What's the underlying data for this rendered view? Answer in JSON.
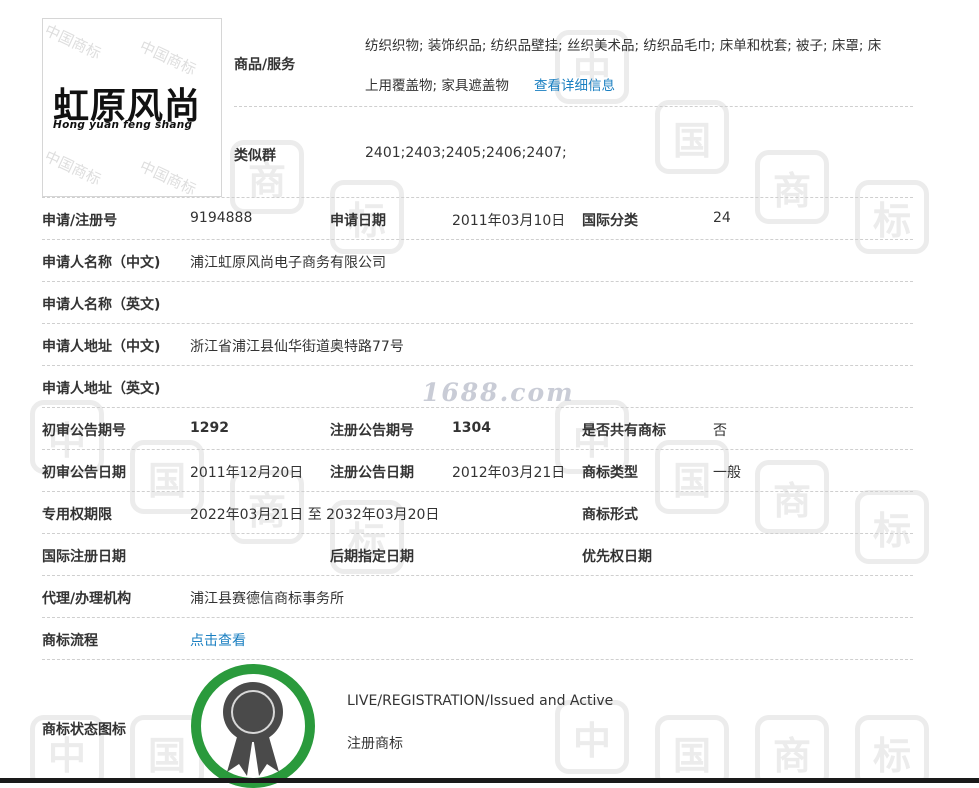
{
  "logo": {
    "main_text": "虹原风尚",
    "sub_text": "Hong yuan feng shang",
    "watermark": "中国商标"
  },
  "goods": {
    "label": "商品/服务",
    "text_line1": "纺织织物; 装饰织品; 纺织品壁挂; 丝织美术品; 纺织品毛巾; 床单和枕套; 被子; 床罩; 床",
    "text_line2": "上用覆盖物; 家具遮盖物",
    "link": "查看详细信息"
  },
  "similar_group": {
    "label": "类似群",
    "value": "2401;2403;2405;2406;2407;"
  },
  "rows": {
    "reg_no_label": "申请/注册号",
    "reg_no": "9194888",
    "apply_date_label": "申请日期",
    "apply_date": "2011年03月10日",
    "intl_class_label": "国际分类",
    "intl_class": "24",
    "applicant_cn_label": "申请人名称（中文)",
    "applicant_cn": "浦江虹原风尚电子商务有限公司",
    "applicant_en_label": "申请人名称（英文)",
    "applicant_en": "",
    "address_cn_label": "申请人地址（中文)",
    "address_cn": "浙江省浦江县仙华街道奥特路77号",
    "address_en_label": "申请人地址（英文)",
    "address_en": "",
    "prelim_no_label": "初审公告期号",
    "prelim_no": "1292",
    "reg_pub_no_label": "注册公告期号",
    "reg_pub_no": "1304",
    "shared_label": "是否共有商标",
    "shared": "否",
    "prelim_date_label": "初审公告日期",
    "prelim_date": "2011年12月20日",
    "reg_pub_date_label": "注册公告日期",
    "reg_pub_date": "2012年03月21日",
    "tm_type_label": "商标类型",
    "tm_type": "一般",
    "exclusive_label": "专用权期限",
    "exclusive": "2022年03月21日 至 2032年03月20日",
    "tm_form_label": "商标形式",
    "tm_form": "",
    "intl_reg_date_label": "国际注册日期",
    "intl_reg_date": "",
    "later_date_label": "后期指定日期",
    "later_date": "",
    "priority_label": "优先权日期",
    "priority": "",
    "agent_label": "代理/办理机构",
    "agent": "浦江县赛德信商标事务所",
    "process_label": "商标流程",
    "process_link": "点击查看",
    "status_label": "商标状态图标",
    "status_en": "LIVE/REGISTRATION/Issued and Active",
    "status_cn": "注册商标"
  },
  "watermark_site": "1688.com",
  "bg_watermark_chars": [
    "中",
    "国",
    "商",
    "标"
  ],
  "colors": {
    "link": "#1a7fc1",
    "seal_green": "#2a9a3c"
  }
}
